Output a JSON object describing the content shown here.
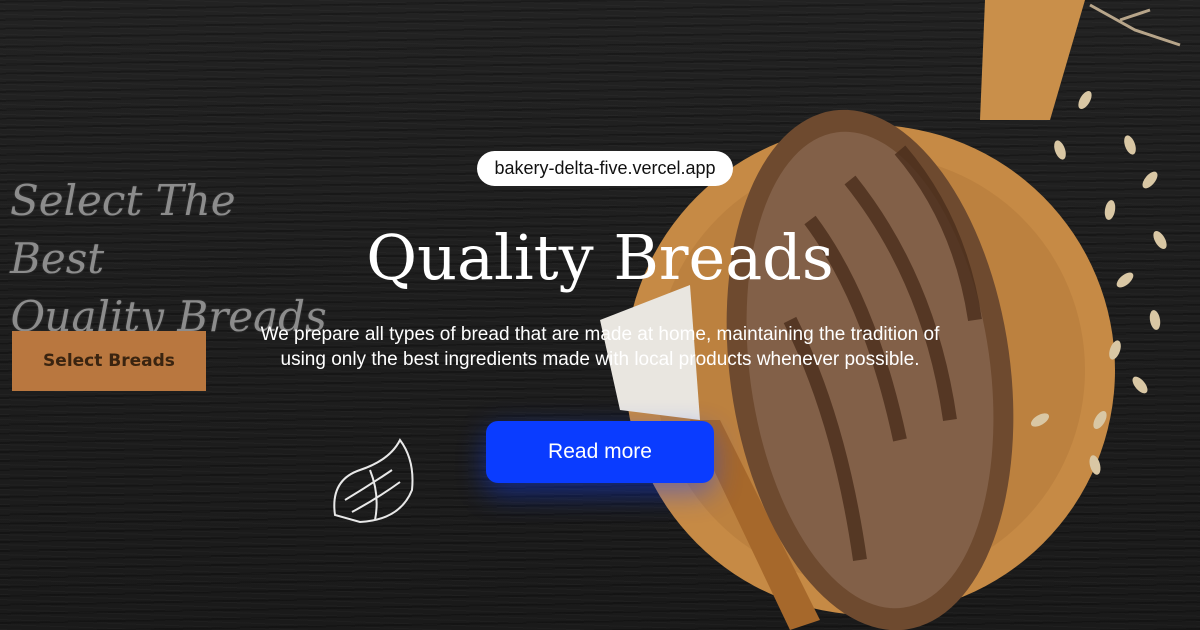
{
  "url_pill": {
    "text": "bakery-delta-five.vercel.app"
  },
  "background": {
    "tagline_line1": "Select The Best",
    "tagline_line2": "Quality Breads",
    "select_button": "Select Breads",
    "accent_color": "#b9773f"
  },
  "hero": {
    "title": "Quality Breads",
    "description": "We prepare all types of bread that are made at home, maintaining the tradition of using only the best ingredients made with local products whenever possible.",
    "cta_label": "Read more",
    "cta_color": "#0a3cff"
  },
  "icons": {
    "croissant": "croissant-icon",
    "bread": "bread-loaf-illustration",
    "board": "cutting-board-illustration"
  }
}
